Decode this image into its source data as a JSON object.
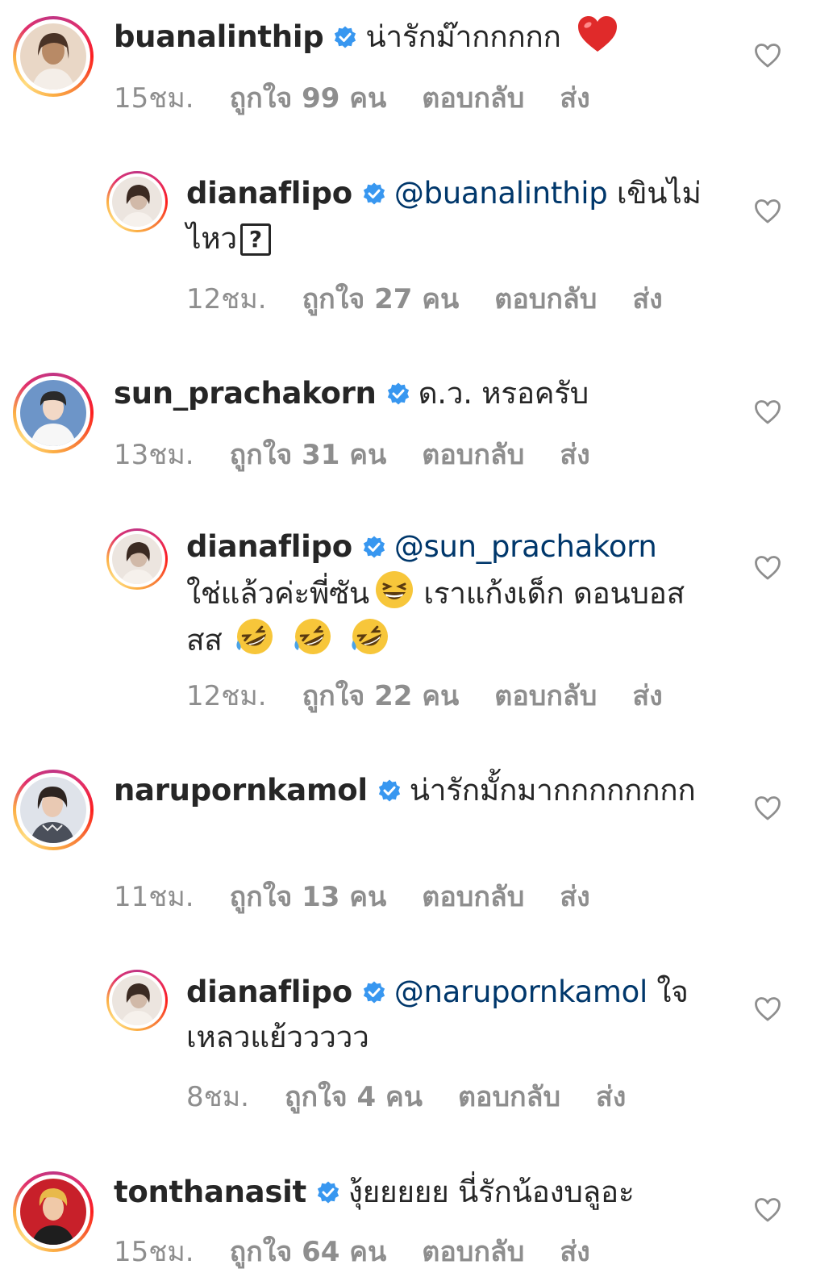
{
  "comments": [
    {
      "kind": "top",
      "username": "buanalinthip",
      "mention": "",
      "text": "น่ารักม๊ากกกกก",
      "time": "15ชม.",
      "likes": "ถูกใจ 99 คน",
      "reply": "ตอบกลับ",
      "send": "ส่ง",
      "avatar_colors": [
        "#e9d7c6",
        "#b88a66",
        "#4a3326"
      ],
      "trailing": "heart-emoji"
    },
    {
      "kind": "reply",
      "username": "dianaflipo",
      "mention": "@buanalinthip",
      "text": " เขินไม่ไหว",
      "time": "12ชม.",
      "likes": "ถูกใจ 27 คน",
      "reply": "ตอบกลับ",
      "send": "ส่ง",
      "avatar_colors": [
        "#ece5df",
        "#d1b9a8",
        "#3b2a22"
      ],
      "trailing": "question-box"
    },
    {
      "kind": "top",
      "username": "sun_prachakorn",
      "mention": "",
      "text": "ด.ว. หรอครับ",
      "time": "13ชม.",
      "likes": "ถูกใจ 31 คน",
      "reply": "ตอบกลับ",
      "send": "ส่ง",
      "avatar_colors": [
        "#6d95c8",
        "#f2d8c6",
        "#2a2a2a"
      ],
      "trailing": ""
    },
    {
      "kind": "reply",
      "username": "dianaflipo",
      "mention": "@sun_prachakorn",
      "text": "ใช่แล้วค่ะพี่ซัน",
      "text2": " เราแก้งเด็ก ดอนบอสสส",
      "time": "12ชม.",
      "likes": "ถูกใจ 22 คน",
      "reply": "ตอบกลับ",
      "send": "ส่ง",
      "avatar_colors": [
        "#ece5df",
        "#d1b9a8",
        "#3b2a22"
      ],
      "trailing": "laugh-emojis"
    },
    {
      "kind": "top",
      "username": "narupornkamol",
      "mention": "",
      "text": "น่ารักมั้กมากกกกกกกก",
      "time": "11ชม.",
      "likes": "ถูกใจ 13 คน",
      "reply": "ตอบกลับ",
      "send": "ส่ง",
      "avatar_colors": [
        "#dfe3ea",
        "#e9c9b3",
        "#2d2420"
      ],
      "trailing": ""
    },
    {
      "kind": "reply",
      "username": "dianaflipo",
      "mention": "@narupornkamol",
      "text": " ใจเหลวแย้ววววว",
      "time": "8ชม.",
      "likes": "ถูกใจ 4 คน",
      "reply": "ตอบกลับ",
      "send": "ส่ง",
      "avatar_colors": [
        "#ece5df",
        "#d1b9a8",
        "#3b2a22"
      ],
      "trailing": ""
    },
    {
      "kind": "top",
      "username": "tonthanasit",
      "mention": "",
      "text": "งุ้ยยยยย นี่รักน้องบลูอะ",
      "time": "15ชม.",
      "likes": "ถูกใจ 64 คน",
      "reply": "ตอบกลับ",
      "send": "ส่ง",
      "avatar_colors": [
        "#c8202a",
        "#f0c9a8",
        "#e8b94a"
      ],
      "trailing": ""
    }
  ],
  "colors": {
    "text": "#262626",
    "meta": "#8e8e8e",
    "mention": "#00376b",
    "verified": "#3897f0"
  }
}
